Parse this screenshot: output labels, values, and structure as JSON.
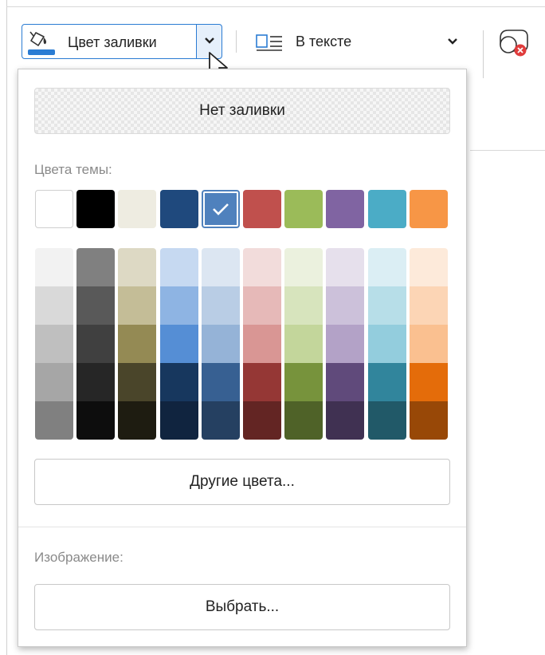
{
  "toolbar": {
    "fill_label": "Цвет заливки",
    "fill_icon": "paint-bucket-icon",
    "fill_current_color": "#2b7cd3",
    "wrap_label": "В тексте",
    "wrap_icon": "text-wrap-inline-icon",
    "shape_icon": "shape-remove-icon"
  },
  "panel": {
    "no_fill_label": "Нет заливки",
    "theme_colors_label": "Цвета темы:",
    "theme_colors": [
      {
        "name": "white",
        "color": "#ffffff"
      },
      {
        "name": "black",
        "color": "#000000"
      },
      {
        "name": "beige",
        "color": "#eeece1"
      },
      {
        "name": "dark-blue",
        "color": "#1f497d"
      },
      {
        "name": "blue",
        "color": "#4f81bd",
        "selected": true
      },
      {
        "name": "red",
        "color": "#c0504d"
      },
      {
        "name": "olive-green",
        "color": "#9bbb59"
      },
      {
        "name": "purple",
        "color": "#8064a2"
      },
      {
        "name": "aqua",
        "color": "#4bacc6"
      },
      {
        "name": "orange",
        "color": "#f79646"
      }
    ],
    "shades": [
      [
        "#f2f2f2",
        "#d9d9d9",
        "#bfbfbf",
        "#a6a6a6",
        "#808080"
      ],
      [
        "#808080",
        "#595959",
        "#404040",
        "#262626",
        "#0d0d0d"
      ],
      [
        "#ddd9c4",
        "#c4bd97",
        "#948a54",
        "#4a452a",
        "#1e1c11"
      ],
      [
        "#c6d9f1",
        "#8eb4e3",
        "#558ed5",
        "#17375e",
        "#10243f"
      ],
      [
        "#dce6f2",
        "#b9cde5",
        "#95b3d7",
        "#376092",
        "#254061"
      ],
      [
        "#f2dcdb",
        "#e6b9b8",
        "#d99694",
        "#953735",
        "#632523"
      ],
      [
        "#ebf1de",
        "#d7e4bd",
        "#c3d69b",
        "#77933c",
        "#4f6228"
      ],
      [
        "#e6e0ec",
        "#ccc1da",
        "#b3a2c7",
        "#604a7b",
        "#403152"
      ],
      [
        "#dbeef4",
        "#b7dee8",
        "#93cddd",
        "#31859c",
        "#215968"
      ],
      [
        "#fdeada",
        "#fcd5b5",
        "#fac090",
        "#e46c0a",
        "#984807"
      ]
    ],
    "more_colors_label": "Другие цвета...",
    "image_label": "Изображение:",
    "choose_label": "Выбрать..."
  }
}
